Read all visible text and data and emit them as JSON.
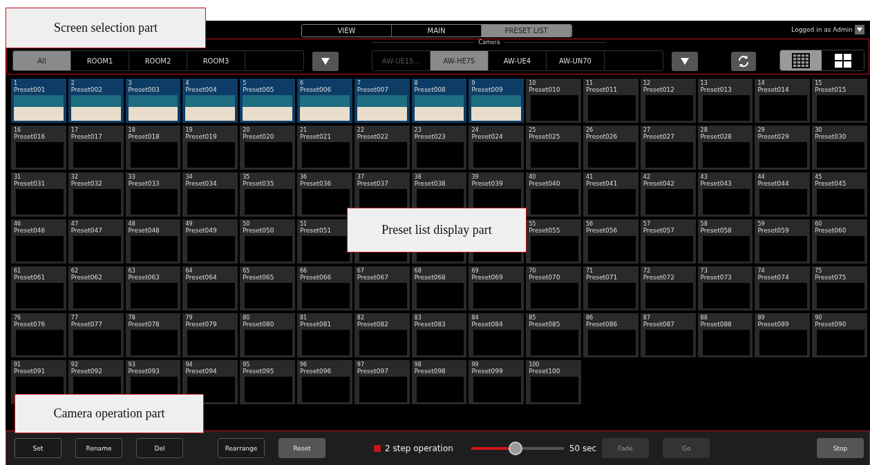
{
  "header": {
    "tabs": [
      {
        "label": "VIEW",
        "selected": false
      },
      {
        "label": "MAIN",
        "selected": false
      },
      {
        "label": "PRESET LIST",
        "selected": true
      }
    ],
    "user": "Logged in as Admin"
  },
  "filters": {
    "camera_label": "Camera",
    "categories": [
      {
        "label": "All",
        "selected": true,
        "disabled": false
      },
      {
        "label": "ROOM1",
        "selected": false,
        "disabled": false
      },
      {
        "label": "ROOM2",
        "selected": false,
        "disabled": false
      },
      {
        "label": "ROOM3",
        "selected": false,
        "disabled": false
      }
    ],
    "cameras": [
      {
        "label": "AW-UE15...",
        "selected": false,
        "disabled": true
      },
      {
        "label": "AW-HE75",
        "selected": true,
        "disabled": false
      },
      {
        "label": "AW-UE4",
        "selected": false,
        "disabled": false
      },
      {
        "label": "AW-UN70",
        "selected": false,
        "disabled": false
      }
    ],
    "layouts": [
      {
        "kind": "grid15",
        "selected": true
      },
      {
        "kind": "grid4",
        "selected": false
      }
    ]
  },
  "presets": [
    {
      "number": "1",
      "name": "Preset001",
      "has_image": true
    },
    {
      "number": "2",
      "name": "Preset002",
      "has_image": true
    },
    {
      "number": "3",
      "name": "Preset003",
      "has_image": true
    },
    {
      "number": "4",
      "name": "Preset004",
      "has_image": true
    },
    {
      "number": "5",
      "name": "Preset005",
      "has_image": true
    },
    {
      "number": "6",
      "name": "Preset006",
      "has_image": true
    },
    {
      "number": "7",
      "name": "Preset007",
      "has_image": true
    },
    {
      "number": "8",
      "name": "Preset008",
      "has_image": true
    },
    {
      "number": "9",
      "name": "Preset009",
      "has_image": true
    },
    {
      "number": "10",
      "name": "Preset010",
      "has_image": false
    },
    {
      "number": "11",
      "name": "Preset011",
      "has_image": false
    },
    {
      "number": "12",
      "name": "Preset012",
      "has_image": false
    },
    {
      "number": "13",
      "name": "Preset013",
      "has_image": false
    },
    {
      "number": "14",
      "name": "Preset014",
      "has_image": false
    },
    {
      "number": "15",
      "name": "Preset015",
      "has_image": false
    },
    {
      "number": "16",
      "name": "Preset016",
      "has_image": false
    },
    {
      "number": "17",
      "name": "Preset017",
      "has_image": false
    },
    {
      "number": "18",
      "name": "Preset018",
      "has_image": false
    },
    {
      "number": "19",
      "name": "Preset019",
      "has_image": false
    },
    {
      "number": "20",
      "name": "Preset020",
      "has_image": false
    },
    {
      "number": "21",
      "name": "Preset021",
      "has_image": false
    },
    {
      "number": "22",
      "name": "Preset022",
      "has_image": false
    },
    {
      "number": "23",
      "name": "Preset023",
      "has_image": false
    },
    {
      "number": "24",
      "name": "Preset024",
      "has_image": false
    },
    {
      "number": "25",
      "name": "Preset025",
      "has_image": false
    },
    {
      "number": "26",
      "name": "Preset026",
      "has_image": false
    },
    {
      "number": "27",
      "name": "Preset027",
      "has_image": false
    },
    {
      "number": "28",
      "name": "Preset028",
      "has_image": false
    },
    {
      "number": "29",
      "name": "Preset029",
      "has_image": false
    },
    {
      "number": "30",
      "name": "Preset030",
      "has_image": false
    },
    {
      "number": "31",
      "name": "Preset031",
      "has_image": false
    },
    {
      "number": "32",
      "name": "Preset032",
      "has_image": false
    },
    {
      "number": "33",
      "name": "Preset033",
      "has_image": false
    },
    {
      "number": "34",
      "name": "Preset034",
      "has_image": false
    },
    {
      "number": "35",
      "name": "Preset035",
      "has_image": false
    },
    {
      "number": "36",
      "name": "Preset036",
      "has_image": false
    },
    {
      "number": "37",
      "name": "Preset037",
      "has_image": false
    },
    {
      "number": "38",
      "name": "Preset038",
      "has_image": false
    },
    {
      "number": "39",
      "name": "Preset039",
      "has_image": false
    },
    {
      "number": "40",
      "name": "Preset040",
      "has_image": false
    },
    {
      "number": "41",
      "name": "Preset041",
      "has_image": false
    },
    {
      "number": "42",
      "name": "Preset042",
      "has_image": false
    },
    {
      "number": "43",
      "name": "Preset043",
      "has_image": false
    },
    {
      "number": "44",
      "name": "Preset044",
      "has_image": false
    },
    {
      "number": "45",
      "name": "Preset045",
      "has_image": false
    },
    {
      "number": "46",
      "name": "Preset046",
      "has_image": false
    },
    {
      "number": "47",
      "name": "Preset047",
      "has_image": false
    },
    {
      "number": "48",
      "name": "Preset048",
      "has_image": false
    },
    {
      "number": "49",
      "name": "Preset049",
      "has_image": false
    },
    {
      "number": "50",
      "name": "Preset050",
      "has_image": false
    },
    {
      "number": "51",
      "name": "Preset051",
      "has_image": false
    },
    {
      "has_image": false
    },
    {
      "has_image": false
    },
    {
      "has_image": false
    },
    {
      "number": "55",
      "name": "Preset055",
      "has_image": false
    },
    {
      "number": "56",
      "name": "Preset056",
      "has_image": false
    },
    {
      "number": "57",
      "name": "Preset057",
      "has_image": false
    },
    {
      "number": "58",
      "name": "Preset058",
      "has_image": false
    },
    {
      "number": "59",
      "name": "Preset059",
      "has_image": false
    },
    {
      "number": "60",
      "name": "Preset060",
      "has_image": false
    },
    {
      "number": "61",
      "name": "Preset061",
      "has_image": false
    },
    {
      "number": "62",
      "name": "Preset062",
      "has_image": false
    },
    {
      "number": "63",
      "name": "Preset063",
      "has_image": false
    },
    {
      "number": "64",
      "name": "Preset064",
      "has_image": false
    },
    {
      "number": "65",
      "name": "Preset065",
      "has_image": false
    },
    {
      "number": "66",
      "name": "Preset066",
      "has_image": false
    },
    {
      "number": "67",
      "name": "Preset067",
      "has_image": false
    },
    {
      "number": "68",
      "name": "Preset068",
      "has_image": false
    },
    {
      "number": "69",
      "name": "Preset069",
      "has_image": false
    },
    {
      "number": "70",
      "name": "Preset070",
      "has_image": false
    },
    {
      "number": "71",
      "name": "Preset071",
      "has_image": false
    },
    {
      "number": "72",
      "name": "Preset072",
      "has_image": false
    },
    {
      "number": "73",
      "name": "Preset073",
      "has_image": false
    },
    {
      "number": "74",
      "name": "Preset074",
      "has_image": false
    },
    {
      "number": "75",
      "name": "Preset075",
      "has_image": false
    },
    {
      "number": "76",
      "name": "Preset076",
      "has_image": false
    },
    {
      "number": "77",
      "name": "Preset077",
      "has_image": false
    },
    {
      "number": "78",
      "name": "Preset078",
      "has_image": false
    },
    {
      "number": "79",
      "name": "Preset079",
      "has_image": false
    },
    {
      "number": "80",
      "name": "Preset080",
      "has_image": false
    },
    {
      "number": "81",
      "name": "Preset081",
      "has_image": false
    },
    {
      "number": "82",
      "name": "Preset082",
      "has_image": false
    },
    {
      "number": "83",
      "name": "Preset083",
      "has_image": false
    },
    {
      "number": "84",
      "name": "Preset084",
      "has_image": false
    },
    {
      "number": "85",
      "name": "Preset085",
      "has_image": false
    },
    {
      "number": "86",
      "name": "Preset086",
      "has_image": false
    },
    {
      "number": "87",
      "name": "Preset087",
      "has_image": false
    },
    {
      "number": "88",
      "name": "Preset088",
      "has_image": false
    },
    {
      "number": "89",
      "name": "Preset089",
      "has_image": false
    },
    {
      "number": "90",
      "name": "Preset090",
      "has_image": false
    },
    {
      "number": "91",
      "name": "Preset091",
      "has_image": false
    },
    {
      "number": "92",
      "name": "Preset092",
      "has_image": false
    },
    {
      "number": "93",
      "name": "Preset093",
      "has_image": false
    },
    {
      "number": "94",
      "name": "Preset094",
      "has_image": false
    },
    {
      "number": "95",
      "name": "Preset095",
      "has_image": false
    },
    {
      "number": "96",
      "name": "Preset096",
      "has_image": false
    },
    {
      "number": "97",
      "name": "Preset097",
      "has_image": false
    },
    {
      "number": "98",
      "name": "Preset098",
      "has_image": false
    },
    {
      "number": "99",
      "name": "Preset099",
      "has_image": false
    },
    {
      "number": "100",
      "name": "Preset100",
      "has_image": false
    }
  ],
  "operation": {
    "buttons_left": [
      {
        "label": "Set",
        "filled": false,
        "disabled": false
      },
      {
        "label": "Rename",
        "filled": false,
        "disabled": false
      },
      {
        "label": "Del",
        "filled": false,
        "disabled": false
      }
    ],
    "buttons_mid": [
      {
        "label": "Rearrange",
        "filled": false,
        "disabled": false
      },
      {
        "label": "Reset",
        "filled": true,
        "disabled": false
      }
    ],
    "two_step": {
      "label": "2 step operation",
      "checked": true
    },
    "speed": {
      "level": 0.48,
      "reading": "50 sec"
    },
    "buttons_right": [
      {
        "label": "Fade",
        "filled": true,
        "disabled": true
      },
      {
        "label": "Go",
        "filled": true,
        "disabled": true
      }
    ],
    "stop": {
      "label": "Stop",
      "filled": true,
      "disabled": false
    }
  },
  "callouts": [
    {
      "text": "Screen selection part"
    },
    {
      "text": "Preset list display part"
    },
    {
      "text": "Camera operation part"
    }
  ]
}
